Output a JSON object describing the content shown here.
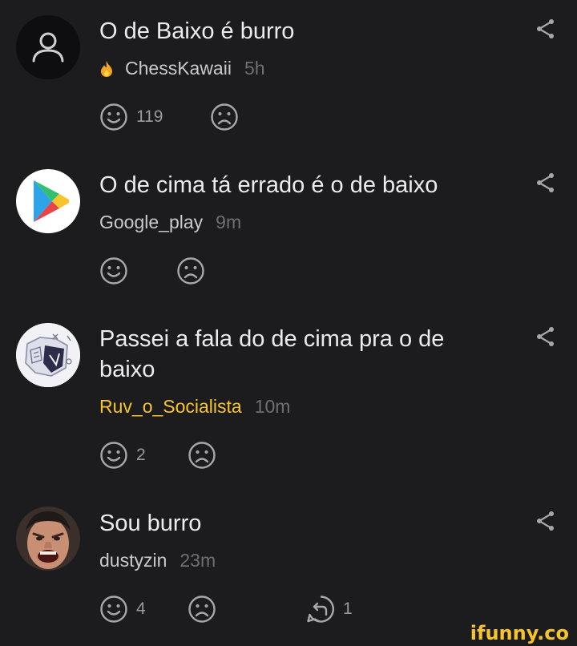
{
  "comments": [
    {
      "text": "O de Baixo é burro",
      "username": "ChessKawaii",
      "time": "5h",
      "likes": "119",
      "avatar": "default-user-icon",
      "badge": "fire-icon"
    },
    {
      "text": "O de cima tá errado é o de baixo",
      "username": "Google_play",
      "time": "9m",
      "avatar": "google-play-logo"
    },
    {
      "text": "Passei a fala do de cima pra o de baixo",
      "username": "Ruv_o_Socialista",
      "time": "10m",
      "likes": "2",
      "avatar": "sketch-drawing-avatar"
    },
    {
      "text": "Sou burro",
      "username": "dustyzin",
      "time": "23m",
      "likes": "4",
      "replies": "1",
      "avatar": "screaming-face-photo"
    }
  ],
  "watermark": "ifunny.co",
  "colors": {
    "background": "#1c1c1f",
    "text": "#ececec",
    "username": "#c9c9c9",
    "highlight_username": "#f7c52b",
    "muted": "#6f6f73",
    "icon": "#a8a8ac"
  }
}
